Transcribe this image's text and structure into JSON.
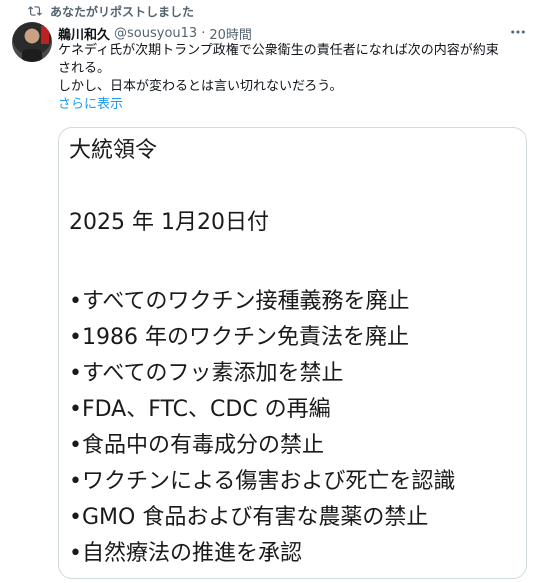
{
  "repost": {
    "icon": "repost-icon",
    "label": "あなたがリポストしました"
  },
  "tweet": {
    "author_name": "鵜川和久",
    "handle": "@sousyou13",
    "separator": "·",
    "time": "20時間",
    "lines": [
      "ケネディ氏が次期トランプ政権で公衆衛生の責任者になれば次の内容が約束",
      "される。",
      "しかし、日本が変わるとは言い切れないだろう。"
    ],
    "show_more": "さらに表示"
  },
  "image_text": {
    "title": "大統領令",
    "date": "2025 年 1月20日付",
    "bullets": [
      "•すべてのワクチン接種義務を廃止",
      "•1986 年のワクチン免責法を廃止",
      "•すべてのフッ素添加を禁止",
      "•FDA、FTC、CDC の再編",
      "•食品中の有毒成分の禁止",
      "•ワクチンによる傷害および死亡を認識",
      "•GMO 食品および有害な農薬の禁止",
      "•自然療法の推進を承認"
    ]
  }
}
